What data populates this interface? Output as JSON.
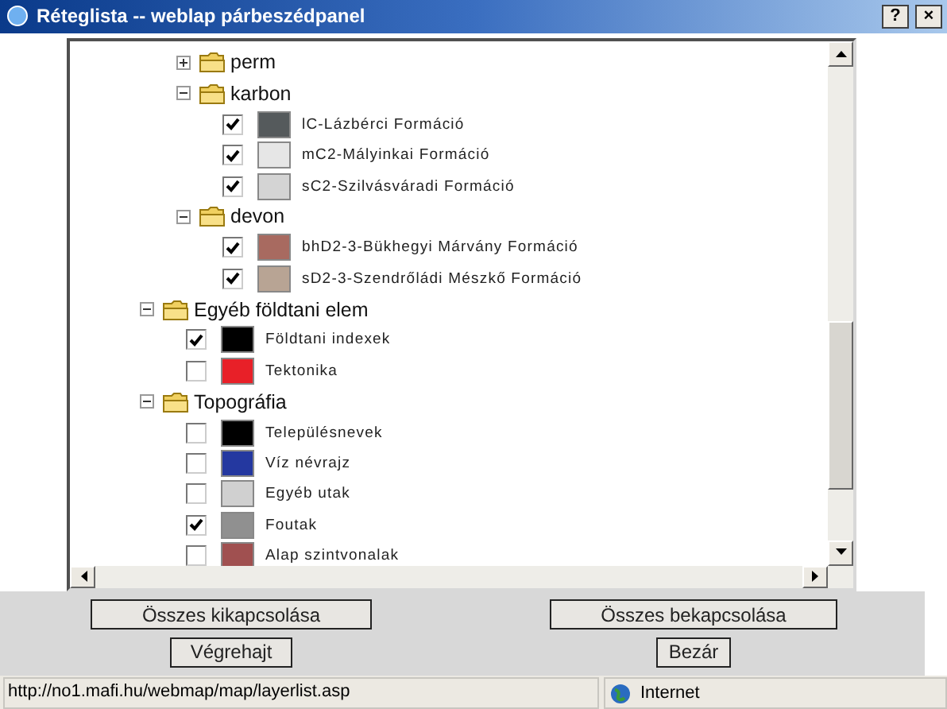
{
  "window": {
    "title": "Réteglista -- weblap párbeszédpanel",
    "controls": [
      "?",
      "×"
    ]
  },
  "tree": [
    {
      "kind": "folder",
      "children": [
        {
          "kind": "folder",
          "label": "perm",
          "expanded": false
        },
        {
          "kind": "folder",
          "label": "karbon",
          "expanded": true,
          "children": [
            {
              "kind": "layer",
              "label": "lC-Lázbérci Formáció",
              "checked": true,
              "color": "#555a5c"
            },
            {
              "kind": "layer",
              "label": "mC2-Mályinkai Formáció",
              "checked": true,
              "color": "#e6e6e6"
            },
            {
              "kind": "layer",
              "label": "sC2-Szilvásváradi Formáció",
              "checked": true,
              "color": "#d4d4d4"
            }
          ]
        },
        {
          "kind": "folder",
          "label": "devon",
          "expanded": true,
          "children": [
            {
              "kind": "layer",
              "label": "bhD2-3-Bükhegyi Márvány Formáció",
              "checked": true,
              "color": "#a86a60"
            },
            {
              "kind": "layer",
              "label": "sD2-3-Szendrőládi Mészkő Formáció",
              "checked": true,
              "color": "#b8a494"
            }
          ]
        }
      ]
    },
    {
      "kind": "folder",
      "label": "Egyéb földtani elem",
      "expanded": true,
      "children": [
        {
          "kind": "layer",
          "label": "Földtani indexek",
          "checked": true,
          "color": "#000000"
        },
        {
          "kind": "layer",
          "label": "Tektonika",
          "checked": false,
          "color": "#e82028"
        }
      ]
    },
    {
      "kind": "folder",
      "label": "Topográfia",
      "expanded": true,
      "children": [
        {
          "kind": "layer",
          "label": "Településnevek",
          "checked": false,
          "color": "#000000"
        },
        {
          "kind": "layer",
          "label": "Víz névrajz",
          "checked": false,
          "color": "#2438a0"
        },
        {
          "kind": "layer",
          "label": "Egyéb utak",
          "checked": false,
          "color": "#d0d0d0"
        },
        {
          "kind": "layer",
          "label": "Foutak",
          "checked": true,
          "color": "#909090"
        },
        {
          "kind": "layer",
          "label": "Alap szintvonalak",
          "checked": false,
          "color": "#a05050"
        }
      ]
    }
  ],
  "buttons": [
    {
      "label": "Összes kikapcsolása"
    },
    {
      "label": "Összes bekapcsolása"
    },
    {
      "label": "Végrehajt"
    },
    {
      "label": "Bezár"
    }
  ],
  "status_bar": {
    "url": "http://no1.mafi.hu/webmap/map/layerlist.asp",
    "zone": "Internet"
  }
}
